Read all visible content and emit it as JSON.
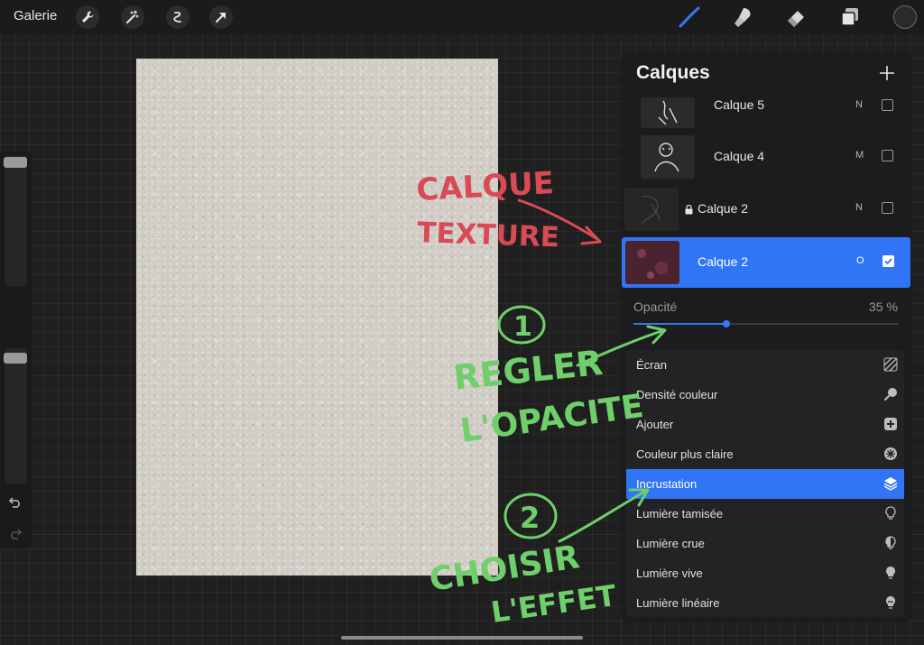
{
  "topbar": {
    "gallery_label": "Galerie",
    "left_tools": [
      "wrench-icon",
      "magic-wand-icon",
      "selection-icon",
      "transform-arrow-icon"
    ],
    "right_tools": [
      "brush-icon",
      "smudge-icon",
      "eraser-icon",
      "layers-icon"
    ],
    "current_color": "#2a2a2a"
  },
  "layers_panel": {
    "title": "Calques",
    "layers": [
      {
        "name": "Calque 5",
        "mode": "N",
        "visible": false,
        "locked": false
      },
      {
        "name": "Calque 4",
        "mode": "M",
        "visible": false,
        "locked": false
      },
      {
        "name": "Calque 2",
        "mode": "N",
        "visible": false,
        "locked": true
      },
      {
        "name": "Calque 2",
        "mode": "O",
        "visible": true,
        "locked": false,
        "selected": true
      }
    ],
    "opacity_label": "Opacité",
    "opacity_value": "35 %",
    "blend_modes": [
      {
        "label": "Écran",
        "icon": "hatched-square-icon"
      },
      {
        "label": "Densité couleur",
        "icon": "dropper-icon"
      },
      {
        "label": "Ajouter",
        "icon": "plus-square-icon"
      },
      {
        "label": "Couleur plus claire",
        "icon": "sparkle-circle-icon"
      },
      {
        "label": "Incrustation",
        "icon": "layers-stack-icon",
        "selected": true
      },
      {
        "label": "Lumière tamisée",
        "icon": "bulb-outline-icon"
      },
      {
        "label": "Lumière crue",
        "icon": "bulb-half-icon"
      },
      {
        "label": "Lumière vive",
        "icon": "bulb-filled-icon"
      },
      {
        "label": "Lumière linéaire",
        "icon": "bulb-linear-icon"
      }
    ]
  },
  "annotations": {
    "texture_line1": "CALQUE",
    "texture_line2": "TEXTURE",
    "step1_number": "1",
    "step1_line1": "REGLER",
    "step1_line2": "L'OPACITE",
    "step2_number": "2",
    "step2_line1": "CHOISIR",
    "step2_line2": "L'EFFET",
    "red_color": "#d94a55",
    "green_color": "#6fcf6a"
  },
  "colors": {
    "accent": "#2f75f6",
    "canvas_paper": "#d1cdc6"
  },
  "opacity_fraction": 0.35
}
